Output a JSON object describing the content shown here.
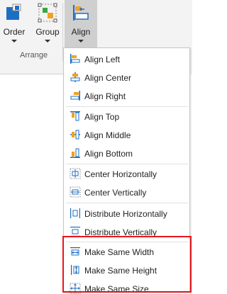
{
  "ribbon": {
    "buttons": [
      {
        "id": "order",
        "label": "Order"
      },
      {
        "id": "group",
        "label": "Group"
      },
      {
        "id": "align",
        "label": "Align"
      }
    ],
    "group_label": "Arrange"
  },
  "menu": {
    "items": [
      {
        "label": "Align Left",
        "icon": "align-left-icon"
      },
      {
        "label": "Align Center",
        "icon": "align-center-icon"
      },
      {
        "label": "Align Right",
        "icon": "align-right-icon"
      },
      {
        "label": "Align Top",
        "icon": "align-top-icon"
      },
      {
        "label": "Align Middle",
        "icon": "align-middle-icon"
      },
      {
        "label": "Align Bottom",
        "icon": "align-bottom-icon"
      },
      {
        "label": "Center Horizontally",
        "icon": "center-horizontally-icon"
      },
      {
        "label": "Center Vertically",
        "icon": "center-vertically-icon"
      },
      {
        "label": "Distribute Horizontally",
        "icon": "distribute-horizontally-icon"
      },
      {
        "label": "Distribute Vertically",
        "icon": "distribute-vertically-icon"
      },
      {
        "label": "Make Same Width",
        "icon": "make-same-width-icon"
      },
      {
        "label": "Make Same Height",
        "icon": "make-same-height-icon"
      },
      {
        "label": "Make Same Size",
        "icon": "make-same-size-icon"
      }
    ]
  },
  "colors": {
    "icon_blue": "#1e6fc2",
    "icon_orange": "#f4a11e",
    "highlight": "#e8161c",
    "pressed": "#cfcfcf"
  }
}
